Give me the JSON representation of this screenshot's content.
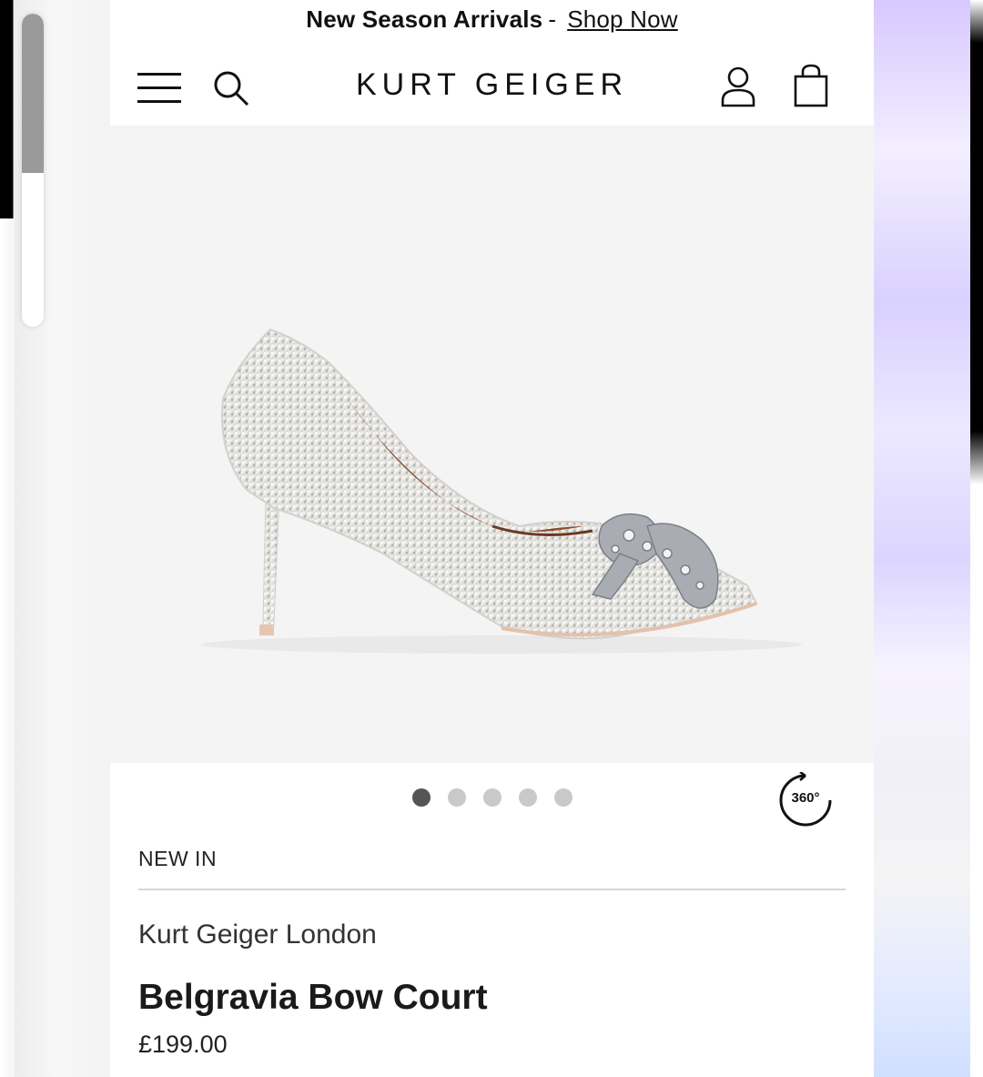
{
  "promo": {
    "bold_text": "New Season Arrivals",
    "separator": "-",
    "link_text": "Shop Now"
  },
  "header": {
    "logo": "KURT GEIGER",
    "icons": [
      "menu-icon",
      "search-icon",
      "account-icon",
      "bag-icon"
    ]
  },
  "gallery": {
    "image_count": 5,
    "active_index": 0,
    "view_360_label": "360°"
  },
  "product": {
    "tag": "NEW IN",
    "brand": "Kurt Geiger London",
    "name": "Belgravia Bow Court",
    "price": "£199.00"
  },
  "colors": {
    "background_panel": "#f4f4f5",
    "active_dot": "#555555",
    "inactive_dot": "#c9c9c9"
  }
}
